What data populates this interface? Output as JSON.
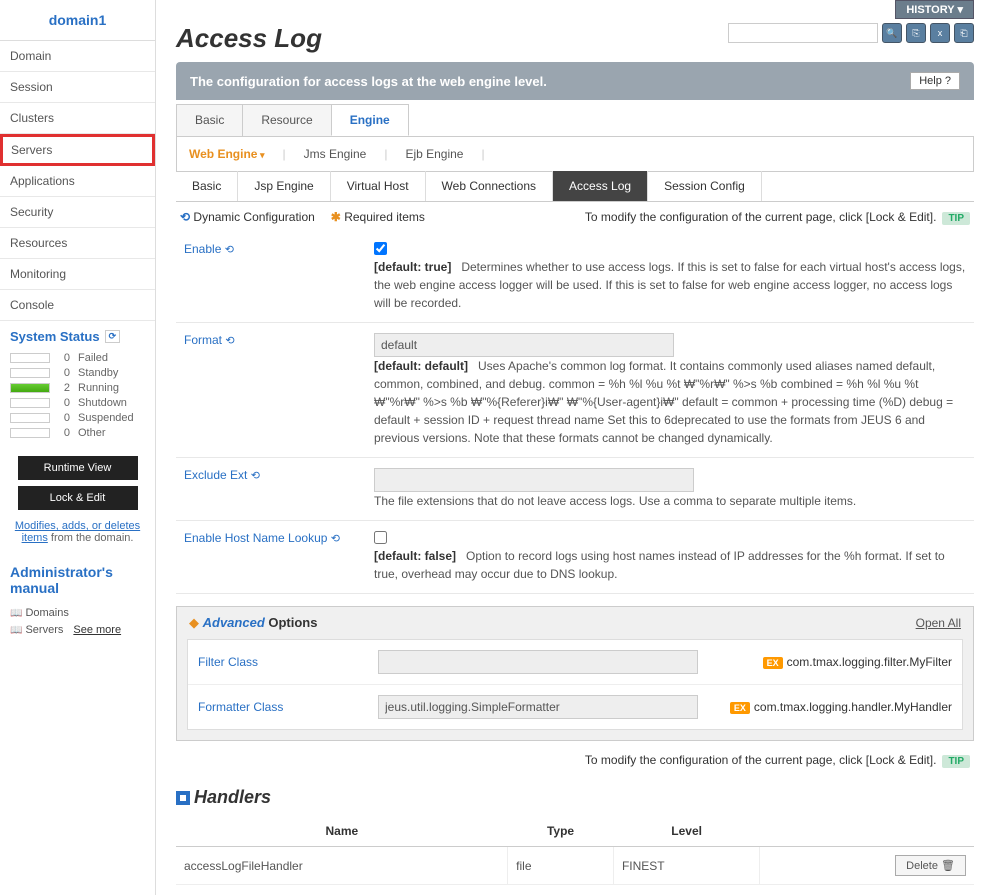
{
  "sidebar": {
    "header": "domain1",
    "items": [
      "Domain",
      "Session",
      "Clusters",
      "Servers",
      "Applications",
      "Security",
      "Resources",
      "Monitoring",
      "Console"
    ],
    "status_title": "System Status",
    "status": [
      {
        "count": "0",
        "label": "Failed"
      },
      {
        "count": "0",
        "label": "Standby"
      },
      {
        "count": "2",
        "label": "Running"
      },
      {
        "count": "0",
        "label": "Shutdown"
      },
      {
        "count": "0",
        "label": "Suspended"
      },
      {
        "count": "0",
        "label": "Other"
      }
    ],
    "runtime_btn": "Runtime View",
    "lock_btn": "Lock & Edit",
    "note_link": "Modifies, adds, or deletes items",
    "note_suffix": " from the domain.",
    "manual_title": "Administrator's manual",
    "manual_links": [
      "Domains",
      "Servers"
    ],
    "see_more": "See more"
  },
  "top": {
    "history": "HISTORY ▾",
    "title": "Access Log",
    "banner": "The configuration for access logs at the web engine level.",
    "help": "Help ?"
  },
  "tabs": {
    "items": [
      "Basic",
      "Resource",
      "Engine"
    ],
    "active": 2
  },
  "subtabs": {
    "items": [
      "Web Engine",
      "Jms Engine",
      "Ejb Engine"
    ],
    "active": 0
  },
  "subnav": {
    "items": [
      "Basic",
      "Jsp Engine",
      "Virtual Host",
      "Web Connections",
      "Access Log",
      "Session Config"
    ],
    "active": 4
  },
  "configbar": {
    "dynamic": "Dynamic Configuration",
    "required": "Required items",
    "tip_text": "To modify the configuration of the current page, click [Lock & Edit].",
    "tip": "TIP"
  },
  "form": {
    "enable": {
      "label": "Enable",
      "checked": true,
      "default": "[default: true]",
      "desc": "Determines whether to use access logs. If this is set to false for each virtual host's access logs, the web engine access logger will be used. If this is set to false for web engine access logger, no access logs will be recorded."
    },
    "format": {
      "label": "Format",
      "value": "default",
      "default": "[default: default]",
      "desc": "Uses Apache's common log format. It contains commonly used aliases named default, common, combined, and debug. common = %h %l %u %t ₩\"%r₩\" %>s %b combined = %h %l %u %t ₩\"%r₩\" %>s %b ₩\"%{Referer}i₩\" ₩\"%{User-agent}i₩\" default = common + processing time (%D) debug = default + session ID + request thread name Set this to 6deprecated to use the formats from JEUS 6 and previous versions. Note that these formats cannot be changed dynamically."
    },
    "exclude": {
      "label": "Exclude Ext",
      "value": "",
      "desc": "The file extensions that do not leave access logs. Use a comma to separate multiple items."
    },
    "hostname": {
      "label": "Enable Host Name Lookup",
      "checked": false,
      "default": "[default: false]",
      "desc": "Option to record logs using host names instead of IP addresses for the %h format. If set to true, overhead may occur due to DNS lookup."
    }
  },
  "advanced": {
    "title_em": "Advanced",
    "title_rest": " Options",
    "open_all": "Open All",
    "rows": [
      {
        "label": "Filter Class",
        "value": "",
        "example": "com.tmax.logging.filter.MyFilter"
      },
      {
        "label": "Formatter Class",
        "value": "jeus.util.logging.SimpleFormatter",
        "example": "com.tmax.logging.handler.MyHandler"
      }
    ],
    "ex": "EX"
  },
  "handlers": {
    "title": "Handlers",
    "cols": [
      "Name",
      "Type",
      "Level",
      ""
    ],
    "rows": [
      {
        "name": "accessLogFileHandler",
        "type": "file",
        "level": "FINEST"
      }
    ],
    "delete": "Delete"
  }
}
